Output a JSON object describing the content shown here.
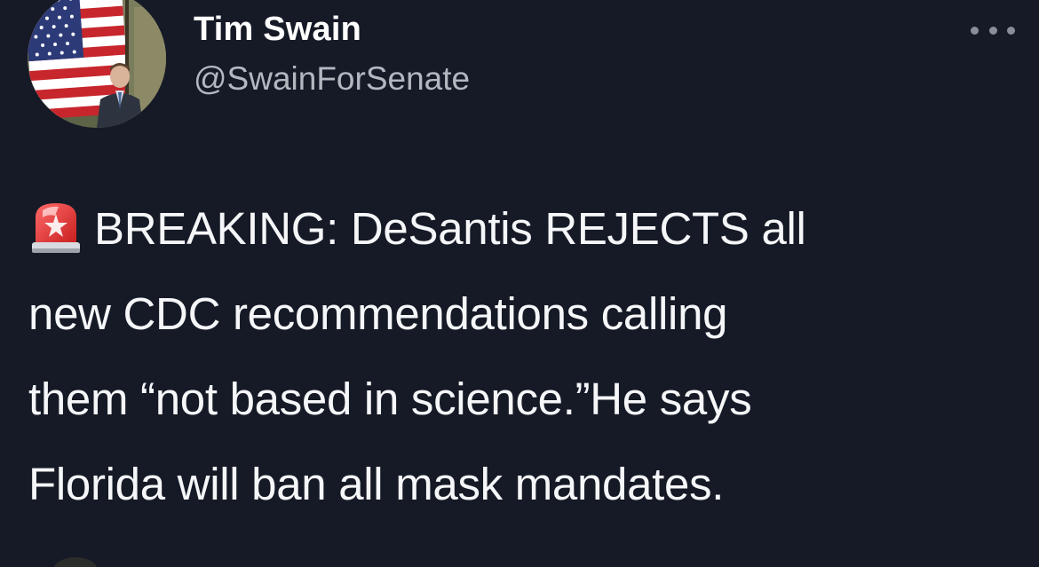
{
  "tweet": {
    "author": {
      "display_name": "Tim Swain",
      "handle": "@SwainForSenate",
      "avatar_icon": "profile-photo-flag"
    },
    "more_icon": "ellipsis-icon",
    "body": {
      "emoji": "police-car-light-icon",
      "line1": "BREAKING: DeSantis REJECTS all",
      "line2": "new CDC recommendations calling",
      "line3": "them “not based in science.”He says",
      "line4": "Florida will ban all mask mandates."
    }
  },
  "colors": {
    "background": "#161a26",
    "text": "#f5f6f8",
    "handle": "#b3b7c0",
    "siren_red": "#e02b2b"
  }
}
